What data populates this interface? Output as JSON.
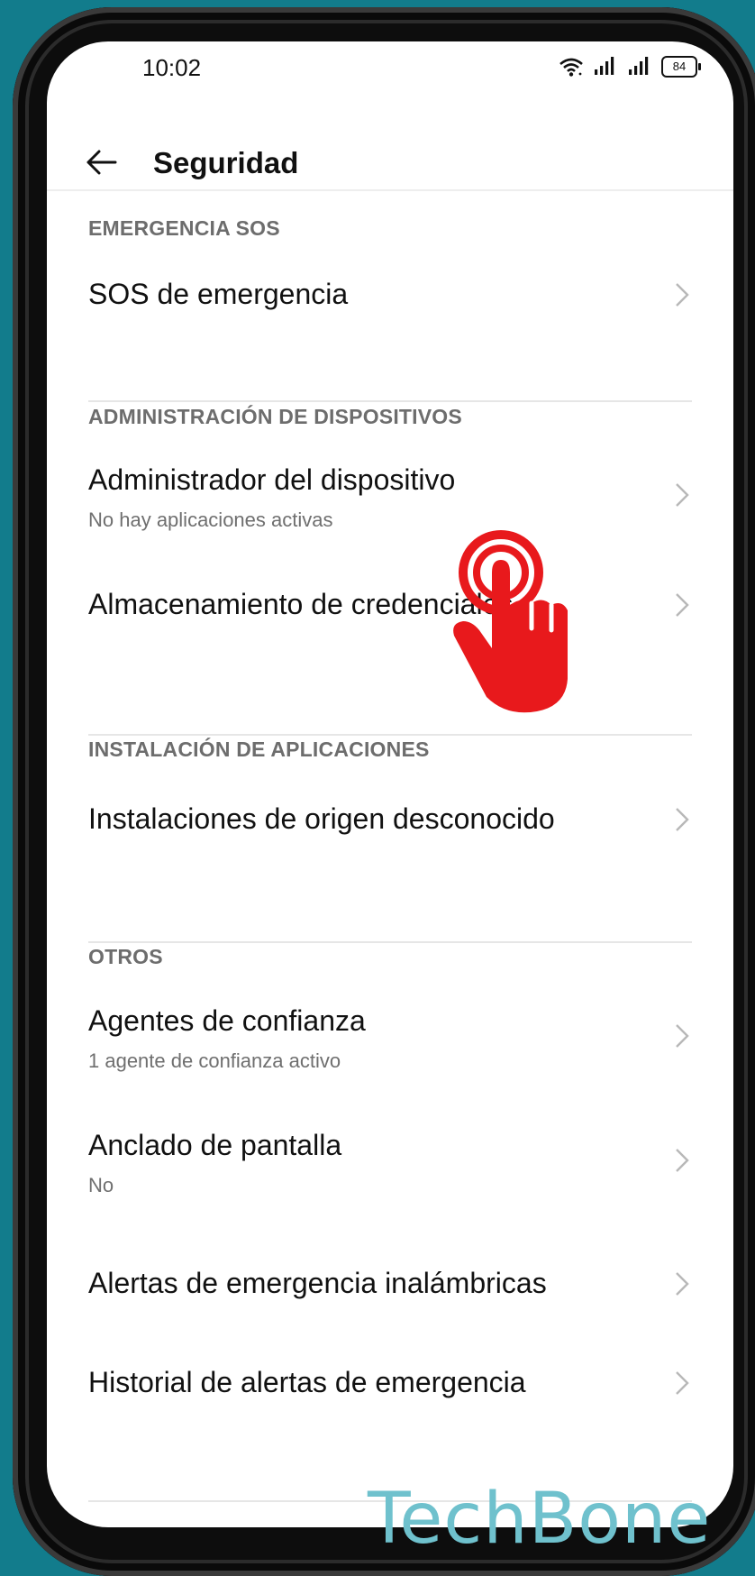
{
  "status_bar": {
    "time": "10:02",
    "battery": "84"
  },
  "header": {
    "title": "Seguridad"
  },
  "sections": {
    "emergency": {
      "header": "EMERGENCIA SOS",
      "items": [
        {
          "title": "SOS de emergencia"
        }
      ]
    },
    "device_admin": {
      "header": "ADMINISTRACIÓN DE DISPOSITIVOS",
      "items": [
        {
          "title": "Administrador del dispositivo",
          "subtitle": "No hay aplicaciones activas"
        },
        {
          "title": "Almacenamiento de credenciales"
        }
      ]
    },
    "app_install": {
      "header": "INSTALACIÓN DE APLICACIONES",
      "items": [
        {
          "title": "Instalaciones de origen desconocido"
        }
      ]
    },
    "others": {
      "header": "OTROS",
      "items": [
        {
          "title": "Agentes de confianza",
          "subtitle": "1 agente de confianza activo"
        },
        {
          "title": "Anclado de pantalla",
          "subtitle": "No"
        },
        {
          "title": "Alertas de emergencia inalámbricas"
        },
        {
          "title": "Historial de alertas de emergencia"
        }
      ]
    }
  },
  "overlay": {
    "hand_icon": "tap-hand-icon",
    "hand_color": "#e8191c"
  },
  "watermark": {
    "text": "TechBone",
    "color": "#6fc1cd"
  }
}
